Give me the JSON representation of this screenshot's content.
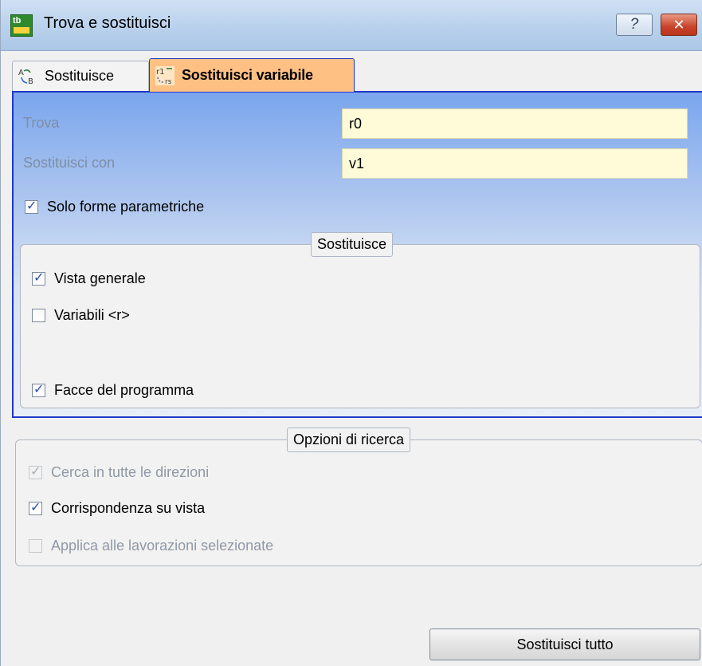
{
  "window": {
    "title": "Trova e sostituisci",
    "help_label": "?",
    "close_label": "✕",
    "app_icon_label": "tb"
  },
  "tabs": [
    {
      "label": "Sostituisce",
      "active": false
    },
    {
      "label": "Sostituisci variabile",
      "active": true
    }
  ],
  "find": {
    "label": "Trova",
    "value": "r0"
  },
  "replace": {
    "label": "Sostituisci con",
    "value": "v1"
  },
  "only_parametric": {
    "label": "Solo forme parametriche",
    "checked": true
  },
  "replace_group": {
    "legend": "Sostituisce",
    "general_view": {
      "label": "Vista generale",
      "checked": true
    },
    "r_variables": {
      "label": "Variabili <r>",
      "checked": false
    },
    "program_faces": {
      "label": "Facce del programma",
      "checked": true
    }
  },
  "search_options": {
    "legend": "Opzioni di ricerca",
    "all_directions": {
      "label": "Cerca in tutte le direzioni",
      "checked": true,
      "enabled": false
    },
    "match_view": {
      "label": "Corrispondenza su vista",
      "checked": true,
      "enabled": true
    },
    "apply_selected": {
      "label": "Applica alle lavorazioni selezionate",
      "checked": false,
      "enabled": false
    }
  },
  "replace_all_button": {
    "label": "Sostituisci tutto"
  },
  "colors": {
    "active_tab": "#ffc183",
    "panel_border": "#1f37c8",
    "field_bg": "#fffbd8",
    "close_button": "#c8432a"
  }
}
